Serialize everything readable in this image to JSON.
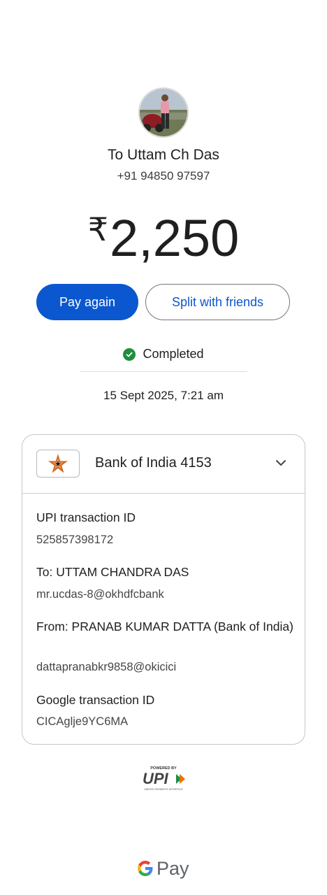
{
  "recipient": {
    "name": "To Uttam Ch Das",
    "phone": "+91 94850 97597"
  },
  "payment": {
    "currency_symbol": "₹",
    "amount": "2,250"
  },
  "actions": {
    "pay_again": "Pay again",
    "split": "Split with friends"
  },
  "status": {
    "label": "Completed",
    "color": "#1e8e3e"
  },
  "datetime": "15 Sept 2025, 7:21 am",
  "card": {
    "bank_name": "Bank of India 4153",
    "details": [
      {
        "label": "UPI transaction ID",
        "value": "525857398172"
      },
      {
        "label": "To: UTTAM CHANDRA DAS",
        "value": "mr.ucdas-8@okhdfcbank"
      },
      {
        "label": "From: PRANAB KUMAR DATTA (Bank of India)",
        "value": "dattapranabkr9858@okicici"
      },
      {
        "label": "Google transaction ID",
        "value": "CICAglje9YC6MA"
      }
    ]
  },
  "footer": {
    "upi_powered": "POWERED BY",
    "upi_mark": "UPI",
    "upi_tagline": "UNIFIED PAYMENTS INTERFACE",
    "brand": "Pay"
  },
  "colors": {
    "primary": "#0b57d0",
    "success": "#1e8e3e"
  }
}
